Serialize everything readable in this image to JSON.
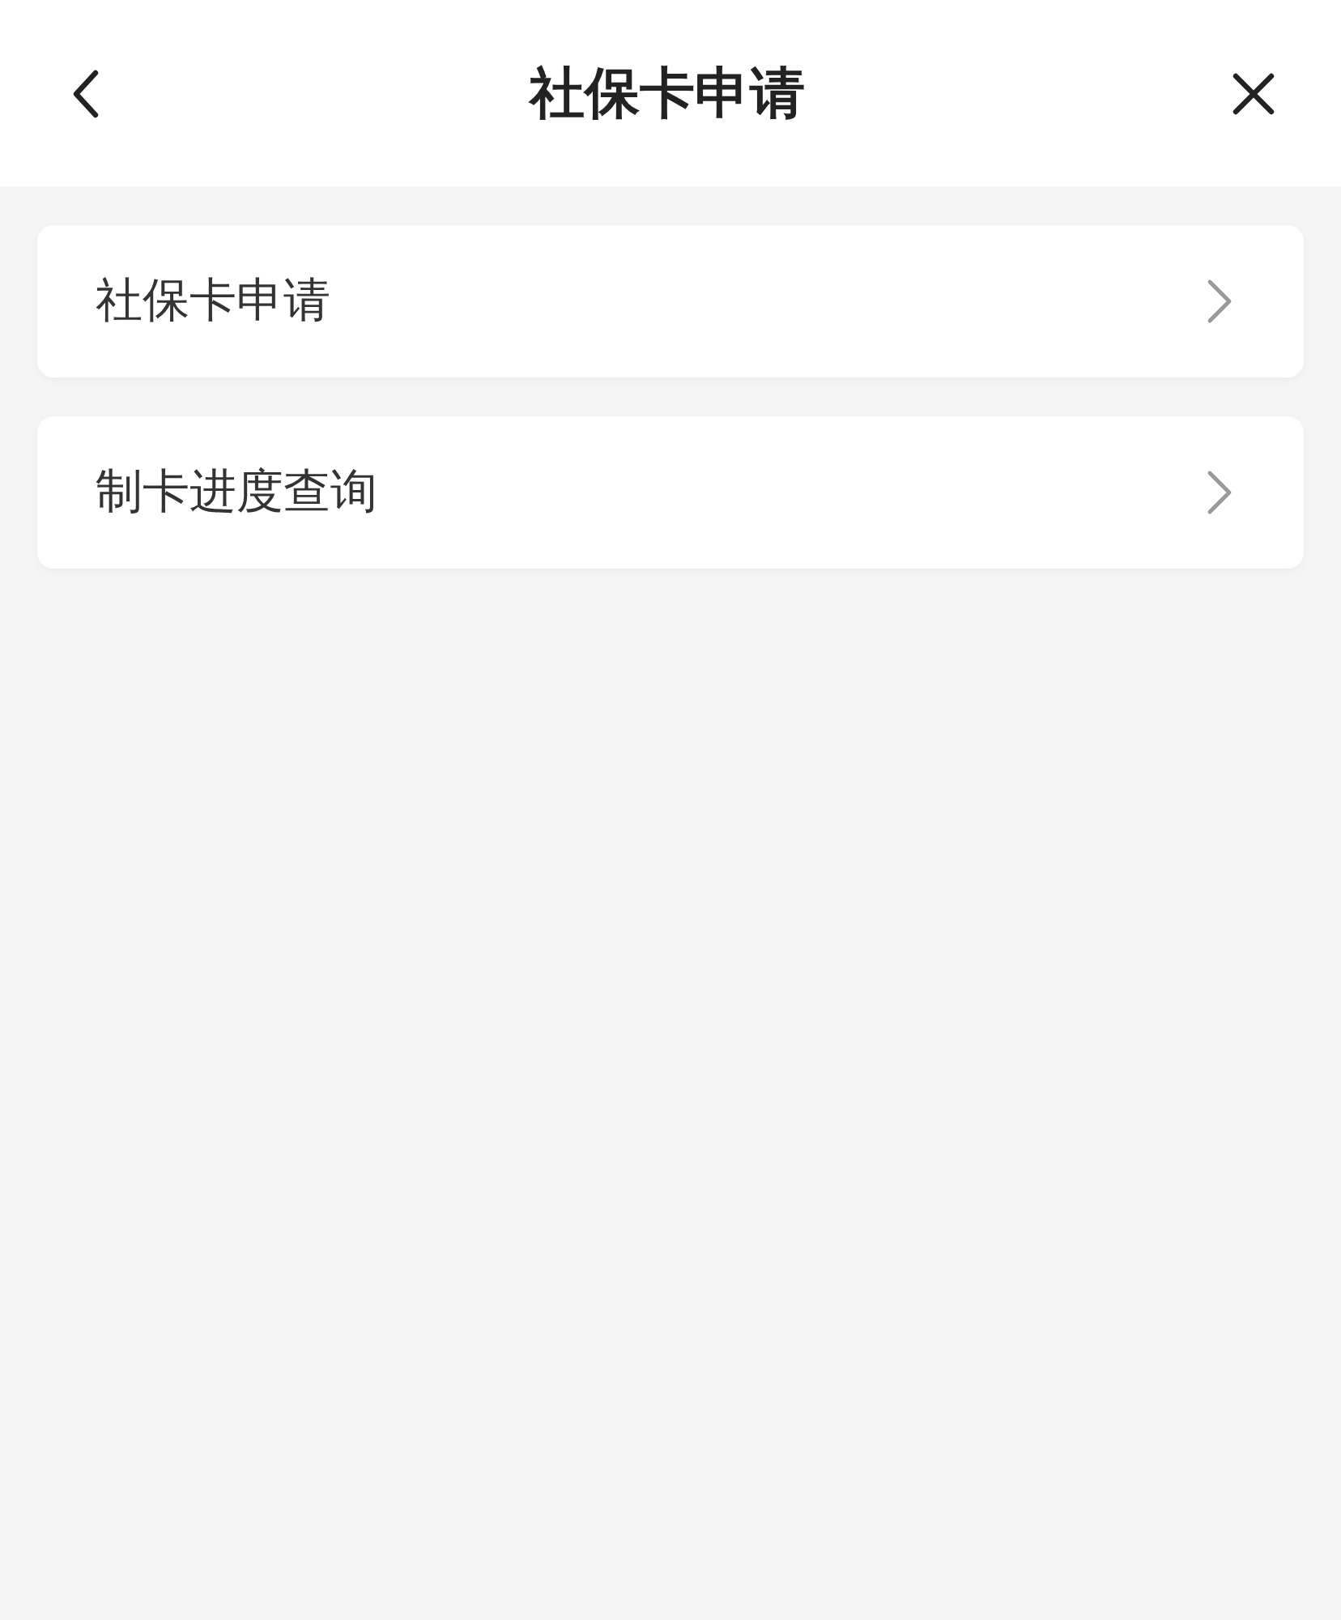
{
  "header": {
    "title": "社保卡申请"
  },
  "menu_items": [
    {
      "label": "社保卡申请"
    },
    {
      "label": "制卡进度查询"
    }
  ]
}
